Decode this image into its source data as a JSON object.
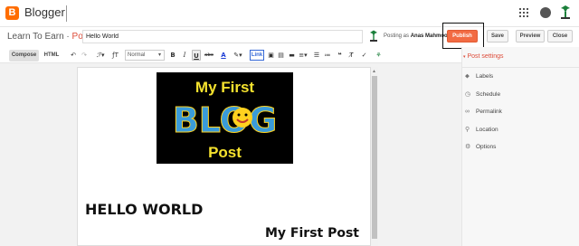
{
  "app": {
    "name": "Blogger"
  },
  "header": {
    "blog_name": "Learn To Earn",
    "separator": "·",
    "section": "Post",
    "post_title": "Hello World",
    "posting_as_label": "Posting as",
    "author": "Anas Mahmood"
  },
  "actions": {
    "publish": "Publish",
    "save": "Save",
    "preview": "Preview",
    "close": "Close"
  },
  "toolbar": {
    "compose": "Compose",
    "html": "HTML",
    "font_size_icon": "ƒT",
    "paragraph_style": "Normal",
    "bold": "B",
    "italic": "I",
    "underline": "U",
    "strike": "abc",
    "text_color": "A",
    "link": "Link"
  },
  "editor": {
    "image": {
      "line1": "My First",
      "line2": "BLOG",
      "line3": "Post"
    },
    "heading1": "HELLO WORLD",
    "heading2": "My First Post"
  },
  "sidebar": {
    "header": "Post settings",
    "items": [
      {
        "label": "Labels",
        "icon": "tag-icon"
      },
      {
        "label": "Schedule",
        "icon": "clock-icon"
      },
      {
        "label": "Permalink",
        "icon": "link-icon"
      },
      {
        "label": "Location",
        "icon": "pin-icon"
      },
      {
        "label": "Options",
        "icon": "gear-icon"
      }
    ]
  },
  "colors": {
    "accent": "#dd4b39",
    "publish": "#f26b43",
    "brand": "#ff6d00"
  }
}
